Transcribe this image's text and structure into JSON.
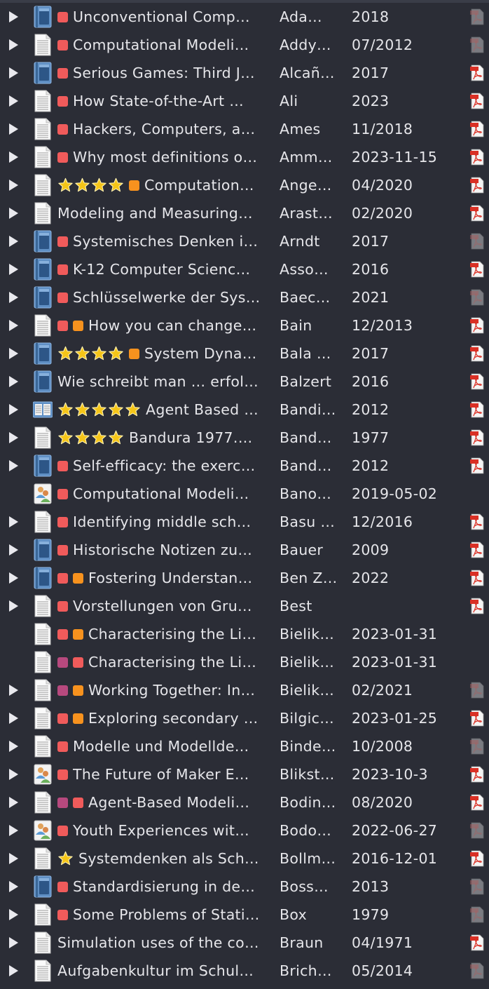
{
  "colors": {
    "tag_red": "#f05b5b",
    "tag_orange": "#f7921e",
    "tag_magenta": "#b7497e",
    "star": "#f5c518",
    "background": "#2b2d36",
    "text": "#e6e6ea"
  },
  "rows": [
    {
      "expandable": true,
      "type": "book",
      "tags": [
        "red"
      ],
      "stars": 0,
      "title": "Unconventional Comp…",
      "creator": "Ada…",
      "date": "2018",
      "pdf": "faded"
    },
    {
      "expandable": true,
      "type": "document",
      "tags": [
        "red"
      ],
      "stars": 0,
      "title": "Computational Modeli…",
      "creator": "Addy…",
      "date": "07/2012",
      "pdf": "faded"
    },
    {
      "expandable": true,
      "type": "book",
      "tags": [
        "red"
      ],
      "stars": 0,
      "title": "Serious Games: Third J…",
      "creator": "Alcañ…",
      "date": "2017",
      "pdf": "yes"
    },
    {
      "expandable": true,
      "type": "document",
      "tags": [
        "red"
      ],
      "stars": 0,
      "title": "How State-of-the-Art …",
      "creator": "Ali",
      "date": "2023",
      "pdf": "yes"
    },
    {
      "expandable": true,
      "type": "document",
      "tags": [
        "red"
      ],
      "stars": 0,
      "title": "Hackers, Computers, a…",
      "creator": "Ames",
      "date": "11/2018",
      "pdf": "yes"
    },
    {
      "expandable": true,
      "type": "document",
      "tags": [
        "red"
      ],
      "stars": 0,
      "title": "Why most definitions o…",
      "creator": "Amm…",
      "date": "2023-11-15",
      "pdf": "yes"
    },
    {
      "expandable": true,
      "type": "document",
      "tags": [
        "orange"
      ],
      "stars": 4,
      "title": "Computation…",
      "creator": "Ange…",
      "date": "04/2020",
      "pdf": "yes"
    },
    {
      "expandable": true,
      "type": "document",
      "tags": [],
      "stars": 0,
      "title": "Modeling and Measuring…",
      "creator": "Arast…",
      "date": "02/2020",
      "pdf": "yes"
    },
    {
      "expandable": true,
      "type": "book",
      "tags": [
        "red"
      ],
      "stars": 0,
      "title": "Systemisches Denken i…",
      "creator": "Arndt",
      "date": "2017",
      "pdf": "faded"
    },
    {
      "expandable": true,
      "type": "book",
      "tags": [
        "red"
      ],
      "stars": 0,
      "title": "K-12 Computer Scienc…",
      "creator": "Asso…",
      "date": "2016",
      "pdf": "yes"
    },
    {
      "expandable": true,
      "type": "book",
      "tags": [
        "red"
      ],
      "stars": 0,
      "title": "Schlüsselwerke der Sys…",
      "creator": "Baec…",
      "date": "2021",
      "pdf": "faded"
    },
    {
      "expandable": true,
      "type": "document",
      "tags": [
        "red",
        "orange"
      ],
      "stars": 0,
      "title": "How you can change…",
      "creator": "Bain",
      "date": "12/2013",
      "pdf": "yes"
    },
    {
      "expandable": true,
      "type": "book",
      "tags": [
        "orange"
      ],
      "stars": 4,
      "title": "System Dyna…",
      "creator": "Bala …",
      "date": "2017",
      "pdf": "yes"
    },
    {
      "expandable": true,
      "type": "book",
      "tags": [],
      "stars": 0,
      "title": "Wie schreibt man … erfol…",
      "creator": "Balzert",
      "date": "2016",
      "pdf": "yes"
    },
    {
      "expandable": true,
      "type": "book-section",
      "tags": [],
      "stars": 5,
      "title": "Agent Based …",
      "creator": "Bandi…",
      "date": "2012",
      "pdf": "yes"
    },
    {
      "expandable": true,
      "type": "document",
      "tags": [],
      "stars": 4,
      "title": "Bandura 1977.…",
      "creator": "Band…",
      "date": "1977",
      "pdf": "yes"
    },
    {
      "expandable": true,
      "type": "book",
      "tags": [
        "red"
      ],
      "stars": 0,
      "title": "Self-efficacy: the exerc…",
      "creator": "Band…",
      "date": "2012",
      "pdf": "yes"
    },
    {
      "expandable": false,
      "type": "presentation",
      "tags": [
        "red"
      ],
      "stars": 0,
      "title": "Computational Modeli…",
      "creator": "Bano…",
      "date": "2019-05-02",
      "pdf": "none"
    },
    {
      "expandable": true,
      "type": "document",
      "tags": [
        "red"
      ],
      "stars": 0,
      "title": "Identifying middle sch…",
      "creator": "Basu …",
      "date": "12/2016",
      "pdf": "yes"
    },
    {
      "expandable": true,
      "type": "book",
      "tags": [
        "red"
      ],
      "stars": 0,
      "title": "Historische Notizen zu…",
      "creator": "Bauer",
      "date": "2009",
      "pdf": "yes"
    },
    {
      "expandable": true,
      "type": "book",
      "tags": [
        "red",
        "orange"
      ],
      "stars": 0,
      "title": "Fostering Understan…",
      "creator": "Ben Z…",
      "date": "2022",
      "pdf": "yes"
    },
    {
      "expandable": true,
      "type": "document",
      "tags": [
        "red"
      ],
      "stars": 0,
      "title": "Vorstellungen von Gru…",
      "creator": "Best",
      "date": "",
      "pdf": "yes"
    },
    {
      "expandable": false,
      "type": "document",
      "tags": [
        "red",
        "orange"
      ],
      "stars": 0,
      "title": "Characterising the Li…",
      "creator": "Bielik…",
      "date": "2023-01-31",
      "pdf": "none"
    },
    {
      "expandable": false,
      "type": "document",
      "tags": [
        "magenta",
        "red"
      ],
      "stars": 0,
      "title": "Characterising the Li…",
      "creator": "Bielik…",
      "date": "2023-01-31",
      "pdf": "none"
    },
    {
      "expandable": true,
      "type": "document",
      "tags": [
        "magenta",
        "orange"
      ],
      "stars": 0,
      "title": "Working Together: In…",
      "creator": "Bielik…",
      "date": "02/2021",
      "pdf": "faded"
    },
    {
      "expandable": true,
      "type": "document",
      "tags": [
        "red",
        "orange"
      ],
      "stars": 0,
      "title": "Exploring secondary …",
      "creator": "Bilgic…",
      "date": "2023-01-25",
      "pdf": "yes"
    },
    {
      "expandable": true,
      "type": "document",
      "tags": [
        "red"
      ],
      "stars": 0,
      "title": "Modelle und Modellde…",
      "creator": "Binde…",
      "date": "10/2008",
      "pdf": "faded"
    },
    {
      "expandable": true,
      "type": "presentation",
      "tags": [
        "red"
      ],
      "stars": 0,
      "title": "The Future of Maker E…",
      "creator": "Blikst…",
      "date": "2023-10-3",
      "pdf": "yes"
    },
    {
      "expandable": true,
      "type": "document",
      "tags": [
        "magenta",
        "red"
      ],
      "stars": 0,
      "title": "Agent-Based Modeli…",
      "creator": "Bodin…",
      "date": "08/2020",
      "pdf": "yes"
    },
    {
      "expandable": true,
      "type": "presentation",
      "tags": [
        "red"
      ],
      "stars": 0,
      "title": "Youth Experiences wit…",
      "creator": "Bodo…",
      "date": "2022-06-27",
      "pdf": "faded"
    },
    {
      "expandable": true,
      "type": "document",
      "tags": [],
      "stars": 1,
      "title": "Systemdenken als Sch…",
      "creator": "Bollm…",
      "date": "2016-12-01",
      "pdf": "yes"
    },
    {
      "expandable": true,
      "type": "book",
      "tags": [
        "red"
      ],
      "stars": 0,
      "title": "Standardisierung in de…",
      "creator": "Boss…",
      "date": "2013",
      "pdf": "faded"
    },
    {
      "expandable": true,
      "type": "document",
      "tags": [
        "red"
      ],
      "stars": 0,
      "title": "Some Problems of Stati…",
      "creator": "Box",
      "date": "1979",
      "pdf": "faded"
    },
    {
      "expandable": true,
      "type": "document",
      "tags": [],
      "stars": 0,
      "title": "Simulation uses of the co…",
      "creator": "Braun",
      "date": "04/1971",
      "pdf": "yes"
    },
    {
      "expandable": true,
      "type": "document",
      "tags": [],
      "stars": 0,
      "title": "Aufgabenkultur im Schul…",
      "creator": "Brich…",
      "date": "05/2014",
      "pdf": "faded"
    }
  ]
}
